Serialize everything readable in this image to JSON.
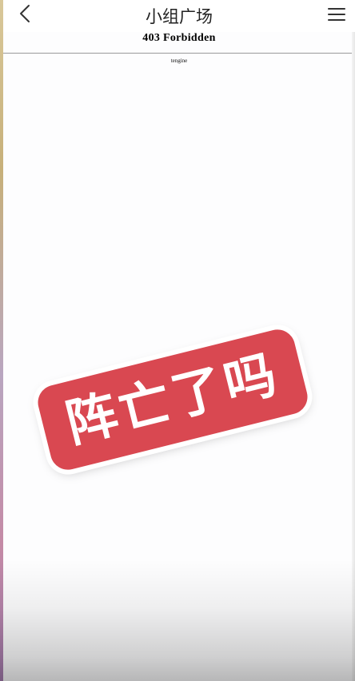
{
  "navbar": {
    "title": "小组广场",
    "back_icon": "chevron-left-icon",
    "menu_icon": "hamburger-menu-icon"
  },
  "error_page": {
    "heading": "403 Forbidden",
    "server": "tengine"
  },
  "overlay": {
    "sticker_text": "阵亡了吗",
    "sticker_color": "#d94851"
  }
}
